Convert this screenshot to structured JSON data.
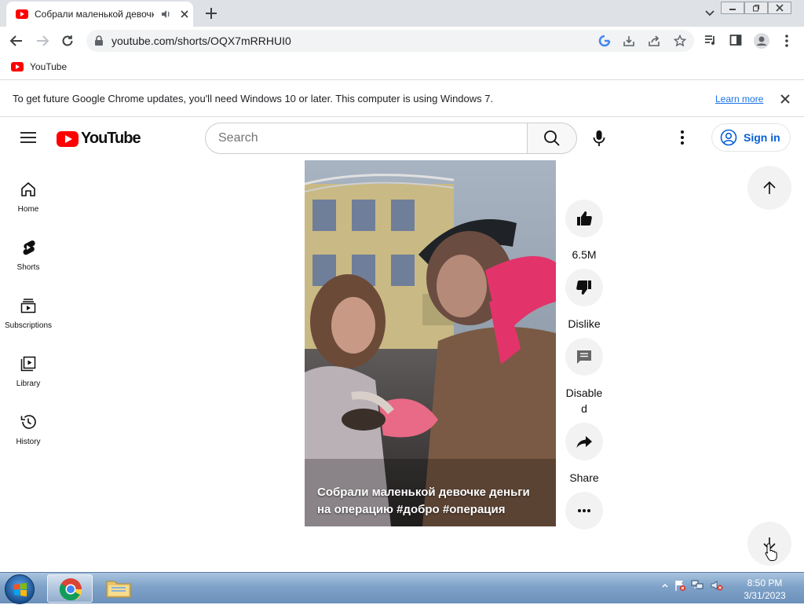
{
  "browser": {
    "tab_title": "Собрали маленькой девочке",
    "url": "youtube.com/shorts/OQX7mRRHUI0",
    "bookmark_label": "YouTube"
  },
  "infobar": {
    "message": "To get future Google Chrome updates, you'll need Windows 10 or later. This computer is using Windows 7.",
    "link": "Learn more"
  },
  "youtube": {
    "logo_text": "YouTube",
    "search_placeholder": "Search",
    "sign_in": "Sign in",
    "guide": [
      {
        "label": "Home",
        "icon": "home-icon"
      },
      {
        "label": "Shorts",
        "icon": "shorts-icon"
      },
      {
        "label": "Subscriptions",
        "icon": "subscriptions-icon"
      },
      {
        "label": "Library",
        "icon": "library-icon"
      },
      {
        "label": "History",
        "icon": "history-icon"
      }
    ],
    "short": {
      "caption_text": "Собрали маленькой девочке деньги на операцию",
      "hashtags": [
        "#добро",
        "#операция"
      ]
    },
    "actions": {
      "like": "6.5M",
      "dislike": "Dislike",
      "comments": "Disable d",
      "share": "Share"
    }
  },
  "taskbar": {
    "time": "8:50 PM",
    "date": "3/31/2023"
  },
  "colors": {
    "youtube_red": "#ff0000",
    "link_blue": "#065fd4",
    "chrome_tabstrip": "#dee1e6"
  }
}
